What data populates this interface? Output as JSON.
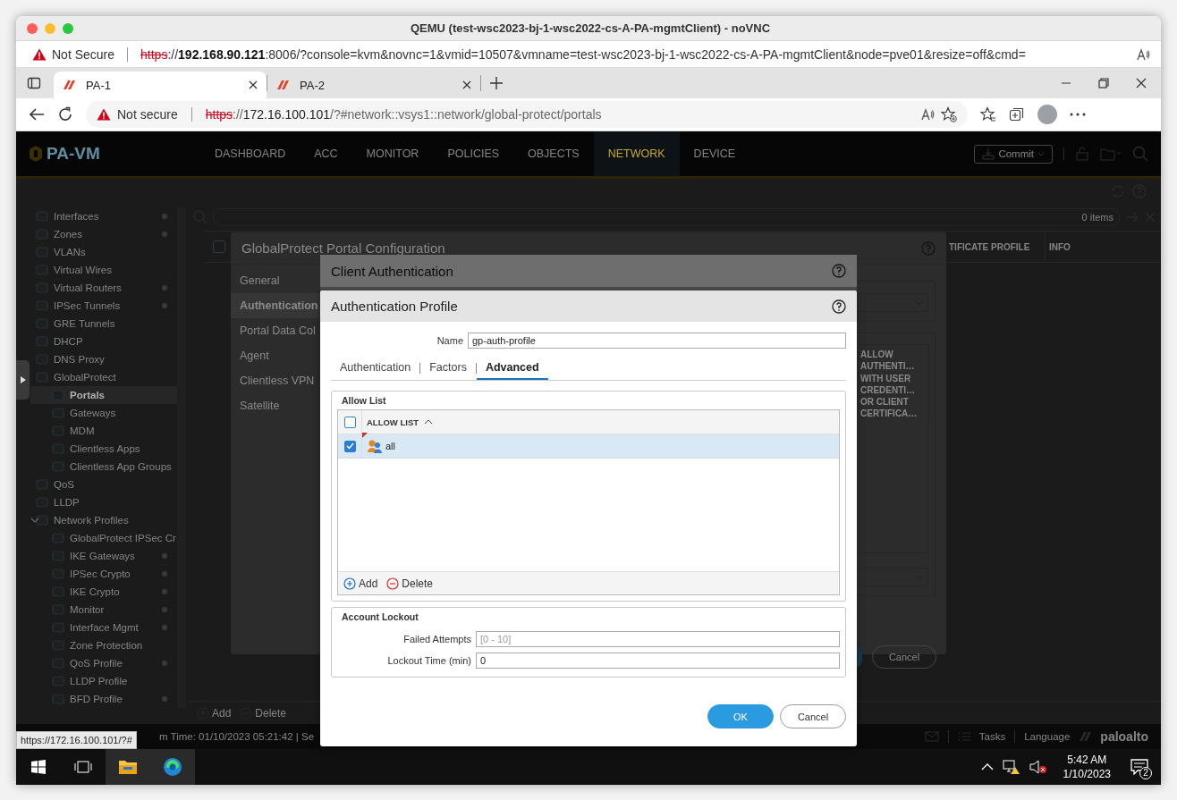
{
  "mac_window": {
    "title": "QEMU (test-wsc2023-bj-1-wsc2022-cs-A-PA-mgmtClient) - noVNC"
  },
  "vnc_address_bar": {
    "security": "Not Secure",
    "scheme": "https",
    "url": "://**192.168.90.121**:8006/?console=kvm&novnc=1&vmid=10507&vmname=test-wsc2023-bj-1-wsc2022-cs-A-PA-mgmtClient&node=pve01&resize=off&cmd="
  },
  "browser": {
    "tabs": [
      {
        "label": "PA-1",
        "selected": true
      },
      {
        "label": "PA-2",
        "selected": false
      }
    ],
    "address": {
      "security": "Not secure",
      "scheme": "https",
      "url": "://**172.16.100.101**/?#network::vsys1::network/global-protect/portals"
    }
  },
  "app": {
    "logo": "PA-VM",
    "nav": [
      {
        "label": "DASHBOARD",
        "selected": false
      },
      {
        "label": "ACC",
        "selected": false
      },
      {
        "label": "MONITOR",
        "selected": false
      },
      {
        "label": "POLICIES",
        "selected": false
      },
      {
        "label": "OBJECTS",
        "selected": false
      },
      {
        "label": "NETWORK",
        "selected": true
      },
      {
        "label": "DEVICE",
        "selected": false
      }
    ],
    "commit": "Commit",
    "sidebar": {
      "items": [
        {
          "label": "Interfaces",
          "selected": false,
          "dot": true
        },
        {
          "label": "Zones",
          "selected": false,
          "dot": true
        },
        {
          "label": "VLANs",
          "selected": false,
          "dot": false
        },
        {
          "label": "Virtual Wires",
          "selected": false,
          "dot": false
        },
        {
          "label": "Virtual Routers",
          "selected": false,
          "dot": true
        },
        {
          "label": "IPSec Tunnels",
          "selected": false,
          "dot": true
        },
        {
          "label": "GRE Tunnels",
          "selected": false,
          "dot": false
        },
        {
          "label": "DHCP",
          "selected": false,
          "dot": false
        },
        {
          "label": "DNS Proxy",
          "selected": false,
          "dot": false
        },
        {
          "label": "GlobalProtect",
          "selected": false,
          "dot": false,
          "children": [
            {
              "label": "Portals",
              "selected": true,
              "dot": false
            },
            {
              "label": "Gateways",
              "selected": false,
              "dot": false
            },
            {
              "label": "MDM",
              "selected": false,
              "dot": false
            },
            {
              "label": "Clientless Apps",
              "selected": false,
              "dot": false
            },
            {
              "label": "Clientless App Groups",
              "selected": false,
              "dot": false
            }
          ]
        },
        {
          "label": "QoS",
          "selected": false,
          "dot": false
        },
        {
          "label": "LLDP",
          "selected": false,
          "dot": false
        },
        {
          "label": "Network Profiles",
          "selected": false,
          "dot": false,
          "expanded": true,
          "children": [
            {
              "label": "GlobalProtect IPSec Cr",
              "selected": false,
              "dot": false
            },
            {
              "label": "IKE Gateways",
              "selected": false,
              "dot": true
            },
            {
              "label": "IPSec Crypto",
              "selected": false,
              "dot": true
            },
            {
              "label": "IKE Crypto",
              "selected": false,
              "dot": true
            },
            {
              "label": "Monitor",
              "selected": false,
              "dot": true
            },
            {
              "label": "Interface Mgmt",
              "selected": false,
              "dot": true
            },
            {
              "label": "Zone Protection",
              "selected": false,
              "dot": false
            },
            {
              "label": "QoS Profile",
              "selected": false,
              "dot": true
            },
            {
              "label": "LLDP Profile",
              "selected": false,
              "dot": false
            },
            {
              "label": "BFD Profile",
              "selected": false,
              "dot": true
            }
          ]
        }
      ]
    },
    "table": {
      "header_checked": false,
      "items_count": "0 items",
      "columns": [
        "TIFICATE PROFILE",
        "INFO"
      ]
    },
    "toolbar": [
      "Add",
      "Delete"
    ],
    "status_bar": {
      "text": "m Time: 01/10/2023 05:21:42 | Se",
      "tasks": "Tasks",
      "language": "Language",
      "brand": "paloalto"
    }
  },
  "portal_dialog": {
    "title": "GlobalProtect Portal Configuration",
    "nav": [
      {
        "label": "General",
        "selected": false
      },
      {
        "label": "Authentication",
        "selected": true
      },
      {
        "label": "Portal Data Col",
        "selected": false
      },
      {
        "label": "Agent",
        "selected": false
      },
      {
        "label": "Clientless VPN",
        "selected": false
      },
      {
        "label": "Satellite",
        "selected": false
      }
    ],
    "column_header": "ALLOW\nAUTHENTI…\nWITH USER\nCREDENTI…\nOR CLIENT\nCERTIFICA…",
    "cancel": "Cancel"
  },
  "client_auth_dialog": {
    "title": "Client Authentication"
  },
  "auth_profile_dialog": {
    "title": "Authentication Profile",
    "name_label": "Name",
    "name_value": "gp-auth-profile",
    "tabs": [
      {
        "label": "Authentication",
        "selected": false
      },
      {
        "label": "Factors",
        "selected": false
      },
      {
        "label": "Advanced",
        "selected": true
      }
    ],
    "allow_list": {
      "legend": "Allow List",
      "header": "ALLOW LIST",
      "header_checked": false,
      "rows": [
        {
          "name": "all",
          "checked": true,
          "selected": true
        }
      ],
      "actions": [
        {
          "kind": "add",
          "label": "Add"
        },
        {
          "kind": "delete",
          "label": "Delete"
        }
      ]
    },
    "account_lockout": {
      "legend": "Account Lockout",
      "fields": [
        {
          "label": "Failed Attempts",
          "placeholder": "[0 - 10]"
        },
        {
          "label": "Lockout Time (min)",
          "value": "0"
        }
      ]
    },
    "buttons": [
      {
        "kind": "primary",
        "label": "OK"
      },
      {
        "kind": "secondary",
        "label": "Cancel"
      }
    ]
  },
  "link_tooltip": "https://172.16.100.101/?#",
  "taskbar": {
    "time": "5:42 AM",
    "date": "1/10/2023",
    "notifications": "2"
  }
}
